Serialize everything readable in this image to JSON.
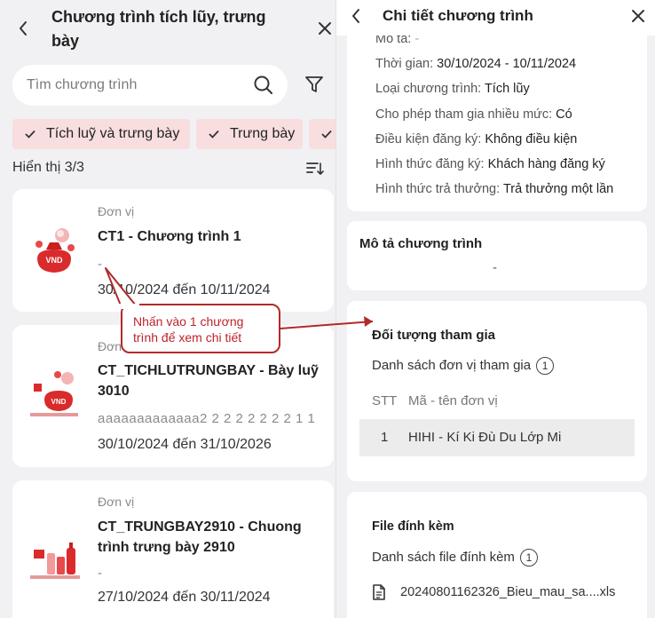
{
  "left": {
    "title": "Chương trình tích lũy, trưng bày",
    "search_placeholder": "Tìm chương trình",
    "chips": [
      "Tích luỹ và trưng bày",
      "Trưng bày"
    ],
    "count": "Hiển thị 3/3",
    "cards": [
      {
        "unit_label": "Đơn vị",
        "name": "CT1 - Chương trình 1",
        "description": "-",
        "date": "30/10/2024 đến 10/11/2024"
      },
      {
        "unit_label": "Đơn vị",
        "name": "CT_TICHLUTRUNGBAY - Bày luỹ 3010",
        "description": "aaaaaaaaaaaaa2 2 2 2 2 2 2 2 1 1",
        "date": "30/10/2024 đến 31/10/2026"
      },
      {
        "unit_label": "Đơn vị",
        "name": "CT_TRUNGBAY2910 - Chuong trình trưng bày 2910",
        "description": "-",
        "date": "27/10/2024 đến 30/11/2024"
      }
    ],
    "image_badge": "VND"
  },
  "callout": {
    "line1": "Nhấn vào 1 chương",
    "line2": "trình để xem chi tiết"
  },
  "right": {
    "title": "Chi tiết chương trình",
    "info": [
      {
        "label": "Mô tả:",
        "value": "-"
      },
      {
        "label": "Thời gian:",
        "value": "30/10/2024 - 10/11/2024"
      },
      {
        "label": "Loại chương trình:",
        "value": "Tích lũy"
      },
      {
        "label": "Cho phép tham gia nhiều mức:",
        "value": "Có"
      },
      {
        "label": "Điều kiện đăng ký:",
        "value": "Không điều kiện"
      },
      {
        "label": "Hình thức đăng ký:",
        "value": "Khách hàng đăng ký"
      },
      {
        "label": "Hình thức trả thưởng:",
        "value": "Trả thưởng một lần"
      }
    ],
    "description_section": {
      "title": "Mô tả chương trình",
      "value": "-"
    },
    "participants": {
      "title": "Đối tượng tham gia",
      "list_label": "Danh sách đơn vị tham gia",
      "list_count": "1",
      "headers": [
        "STT",
        "Mã - tên đơn vị"
      ],
      "rows": [
        {
          "stt": "1",
          "name": "HIHI - Kí Ki Đù Du Lớp Mi"
        }
      ]
    },
    "attachments": {
      "title": "File đính kèm",
      "list_label": "Danh sách file đính kèm",
      "list_count": "1",
      "file_name": "20240801162326_Bieu_mau_sa....xls"
    }
  },
  "colors": {
    "chip_bg": "#f8dede",
    "callout_border": "#b22a2a",
    "callout_text": "#c0222a",
    "panel_bg": "#f1f1f3"
  }
}
